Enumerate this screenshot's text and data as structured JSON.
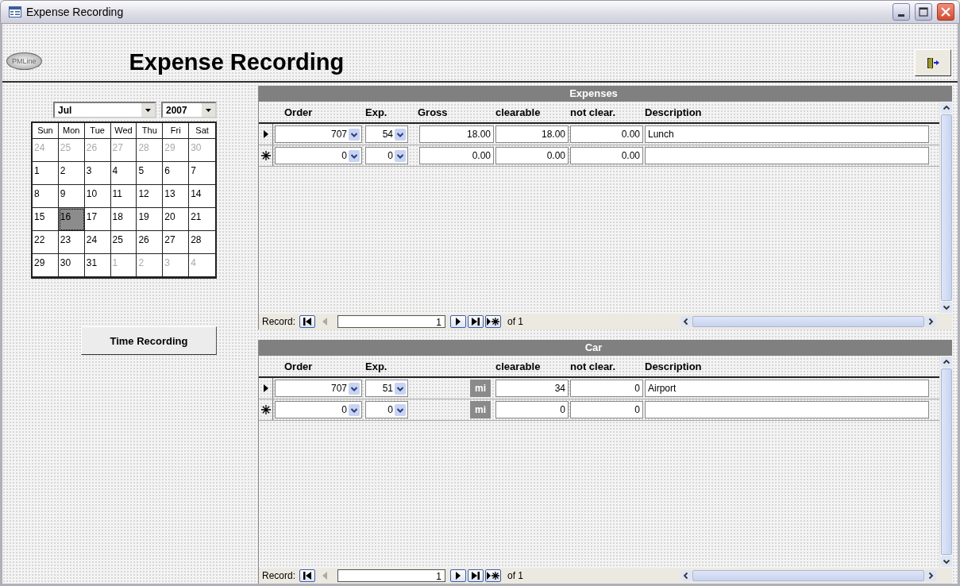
{
  "window": {
    "title": "Expense Recording"
  },
  "header": {
    "logo_text": "PMLine",
    "title": "Expense Recording"
  },
  "calendar": {
    "month": "Jul",
    "year": "2007",
    "weekdays": [
      "Sun",
      "Mon",
      "Tue",
      "Wed",
      "Thu",
      "Fri",
      "Sat"
    ],
    "days": [
      {
        "label": "24",
        "in_month": false,
        "selected": false
      },
      {
        "label": "25",
        "in_month": false,
        "selected": false
      },
      {
        "label": "26",
        "in_month": false,
        "selected": false
      },
      {
        "label": "27",
        "in_month": false,
        "selected": false
      },
      {
        "label": "28",
        "in_month": false,
        "selected": false
      },
      {
        "label": "29",
        "in_month": false,
        "selected": false
      },
      {
        "label": "30",
        "in_month": false,
        "selected": false
      },
      {
        "label": "1",
        "in_month": true,
        "selected": false
      },
      {
        "label": "2",
        "in_month": true,
        "selected": false
      },
      {
        "label": "3",
        "in_month": true,
        "selected": false
      },
      {
        "label": "4",
        "in_month": true,
        "selected": false
      },
      {
        "label": "5",
        "in_month": true,
        "selected": false
      },
      {
        "label": "6",
        "in_month": true,
        "selected": false
      },
      {
        "label": "7",
        "in_month": true,
        "selected": false
      },
      {
        "label": "8",
        "in_month": true,
        "selected": false
      },
      {
        "label": "9",
        "in_month": true,
        "selected": false
      },
      {
        "label": "10",
        "in_month": true,
        "selected": false
      },
      {
        "label": "11",
        "in_month": true,
        "selected": false
      },
      {
        "label": "12",
        "in_month": true,
        "selected": false
      },
      {
        "label": "13",
        "in_month": true,
        "selected": false
      },
      {
        "label": "14",
        "in_month": true,
        "selected": false
      },
      {
        "label": "15",
        "in_month": true,
        "selected": false
      },
      {
        "label": "16",
        "in_month": true,
        "selected": true
      },
      {
        "label": "17",
        "in_month": true,
        "selected": false
      },
      {
        "label": "18",
        "in_month": true,
        "selected": false
      },
      {
        "label": "19",
        "in_month": true,
        "selected": false
      },
      {
        "label": "20",
        "in_month": true,
        "selected": false
      },
      {
        "label": "21",
        "in_month": true,
        "selected": false
      },
      {
        "label": "22",
        "in_month": true,
        "selected": false
      },
      {
        "label": "23",
        "in_month": true,
        "selected": false
      },
      {
        "label": "24",
        "in_month": true,
        "selected": false
      },
      {
        "label": "25",
        "in_month": true,
        "selected": false
      },
      {
        "label": "26",
        "in_month": true,
        "selected": false
      },
      {
        "label": "27",
        "in_month": true,
        "selected": false
      },
      {
        "label": "28",
        "in_month": true,
        "selected": false
      },
      {
        "label": "29",
        "in_month": true,
        "selected": false
      },
      {
        "label": "30",
        "in_month": true,
        "selected": false
      },
      {
        "label": "31",
        "in_month": true,
        "selected": false
      },
      {
        "label": "1",
        "in_month": false,
        "selected": false
      },
      {
        "label": "2",
        "in_month": false,
        "selected": false
      },
      {
        "label": "3",
        "in_month": false,
        "selected": false
      },
      {
        "label": "4",
        "in_month": false,
        "selected": false
      }
    ]
  },
  "time_button": "Time Recording",
  "subforms": [
    {
      "title": "Expenses",
      "headings": {
        "order": "Order",
        "exp": "Exp.",
        "gross": "Gross",
        "clearable": "clearable",
        "not_clear": "not clear.",
        "description": "Description"
      },
      "rows": [
        {
          "kind": "current",
          "order": "707",
          "exp": "54",
          "gross": "18.00",
          "clearable": "18.00",
          "not_clear": "0.00",
          "description": "Lunch"
        },
        {
          "kind": "new",
          "order": "0",
          "exp": "0",
          "gross": "0.00",
          "clearable": "0.00",
          "not_clear": "0.00"
        }
      ],
      "nav": {
        "label": "Record:",
        "current": "1",
        "total": "of 1"
      }
    },
    {
      "title": "Car",
      "headings": {
        "order": "Order",
        "exp": "Exp.",
        "clearable": "clearable",
        "not_clear": "not clear.",
        "description": "Description"
      },
      "rows": [
        {
          "kind": "current",
          "order": "707",
          "exp": "51",
          "unit": "mi",
          "clearable": "34",
          "not_clear": "0",
          "description": "Airport"
        },
        {
          "kind": "new",
          "order": "0",
          "exp": "0",
          "unit": "mi",
          "clearable": "0",
          "not_clear": "0"
        }
      ],
      "nav": {
        "label": "Record:",
        "current": "1",
        "total": "of 1"
      }
    }
  ]
}
